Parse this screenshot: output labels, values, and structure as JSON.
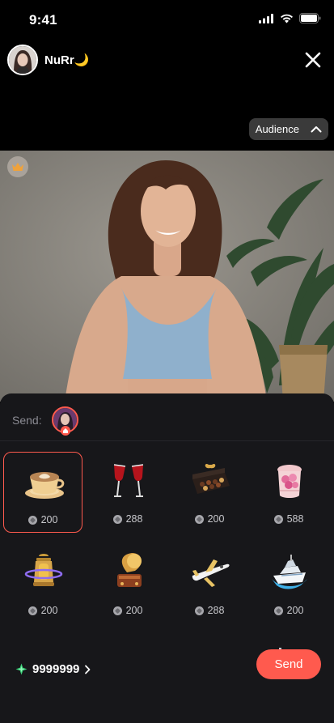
{
  "status": {
    "time": "9:41"
  },
  "host": {
    "name": "NuRr🌙"
  },
  "audience": {
    "label": "Audience"
  },
  "panel": {
    "send_label": "Send:"
  },
  "gifts": [
    {
      "name": "coffee",
      "price": "200",
      "selected": true
    },
    {
      "name": "wine-glasses",
      "price": "288"
    },
    {
      "name": "chocolate-box",
      "price": "200"
    },
    {
      "name": "rose-box",
      "price": "588"
    },
    {
      "name": "lantern",
      "price": "200"
    },
    {
      "name": "gramophone",
      "price": "200"
    },
    {
      "name": "private-jet",
      "price": "288"
    },
    {
      "name": "yacht",
      "price": "200"
    }
  ],
  "wallet": {
    "balance": "9999999"
  },
  "actions": {
    "send_label": "Send"
  },
  "colors": {
    "accent": "#ff5a4e",
    "panel": "#17171a",
    "gem": "#3ad67a"
  }
}
